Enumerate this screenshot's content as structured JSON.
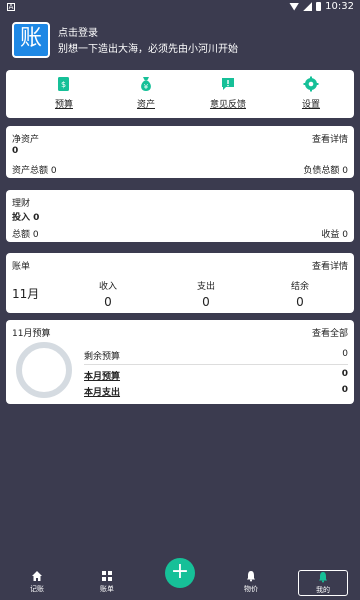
{
  "status_bar": {
    "time": "10:32",
    "left_icon": "A"
  },
  "header": {
    "logo_char": "账",
    "login_title": "点击登录",
    "subtitle": "别想一下造出大海，必须先由小河川开始"
  },
  "menu": [
    {
      "label": "预算",
      "icon": "budget-icon"
    },
    {
      "label": "资产",
      "icon": "money-bag-icon"
    },
    {
      "label": "意见反馈",
      "icon": "feedback-icon"
    },
    {
      "label": "设置",
      "icon": "gear-icon"
    }
  ],
  "net_assets": {
    "title": "净资产",
    "details": "查看详情",
    "value": "0",
    "total_assets_label": "资产总额",
    "total_assets_value": "0",
    "total_liabilities_label": "负债总额",
    "total_liabilities_value": "0"
  },
  "finance": {
    "title": "理财",
    "investment_label": "投入",
    "investment_value": "0",
    "total_label": "总额",
    "total_value": "0",
    "income_label": "收益",
    "income_value": "0"
  },
  "bill": {
    "title": "账单",
    "details": "查看详情",
    "month": "11月",
    "income_label": "收入",
    "income_value": "0",
    "expense_label": "支出",
    "expense_value": "0",
    "balance_label": "结余",
    "balance_value": "0"
  },
  "budget": {
    "title": "11月预算",
    "view_all": "查看全部",
    "remaining_label": "剩余预算",
    "remaining_value": "0",
    "month_budget_label": "本月预算",
    "month_budget_value": "0",
    "month_spent_label": "本月支出",
    "month_spent_value": "0"
  },
  "bottom_tabs": [
    {
      "label": "记账",
      "icon": "home-icon"
    },
    {
      "label": "账单",
      "icon": "grid-icon"
    },
    {
      "label": "",
      "icon": "plus-icon"
    },
    {
      "label": "物价",
      "icon": "bell-icon"
    },
    {
      "label": "我的",
      "icon": "bell-icon"
    }
  ],
  "colors": {
    "accent": "#16c098",
    "background": "#3b3b4f",
    "card": "#ffffff"
  }
}
